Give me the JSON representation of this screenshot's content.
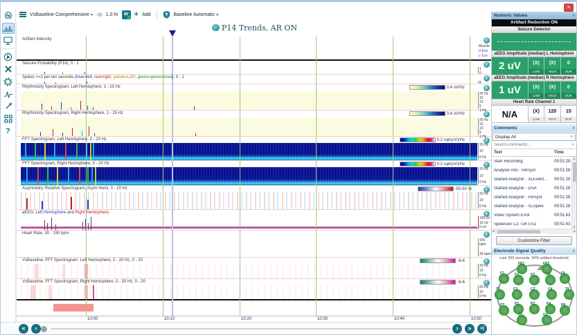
{
  "window": {
    "close": "×"
  },
  "glyphs": {
    "caret": "▾",
    "arrows": "◁▷",
    "plus": "+",
    "help": "?",
    "info": "i",
    "back_fast": "«",
    "back": "‹",
    "fwd": "›",
    "fwd_fast": "»",
    "fwd_end": "»|",
    "panel_close": "×",
    "dropdown_caret": "˅",
    "search": "⌕",
    "up": "▲",
    "down": "▼",
    "hleft": "◂",
    "hright": "▸"
  },
  "toolbar": {
    "preset": "VsBaseline Comprehensive",
    "timescale": "1.0 hr",
    "ar_badge": "ar",
    "add_label": "Add",
    "baseline": "Baseline Automatic"
  },
  "main": {
    "title": "P14 Trends, AR ON",
    "time_ticks": [
      "10:00",
      "10:10",
      "10:20",
      "10:30",
      "10:40",
      "10:50"
    ],
    "rows": [
      {
        "id": "artifact-intensity",
        "label": "Artifact Intensity",
        "axis": [
          "Muscle",
          "V-Eye",
          "L-Eye"
        ]
      },
      {
        "id": "seizure-probability",
        "label": "Seizure Probability (P14), 0 - 1",
        "axis": [
          "1",
          "0"
        ]
      },
      {
        "id": "spikes",
        "parts": [
          {
            "t": "Spikes >=3 per ten seconds ("
          },
          {
            "t": "blue=left",
            "c": "#2040c0"
          },
          {
            "t": ", "
          },
          {
            "t": "red=right",
            "c": "#c02020"
          },
          {
            "t": ", "
          },
          {
            "t": "yellow=L&R",
            "c": "#a89000"
          },
          {
            "t": ", "
          },
          {
            "t": "green=generalized",
            "c": "#1e8a2e"
          },
          {
            "t": "), 0 - 1"
          }
        ],
        "axis": [
          "8"
        ]
      },
      {
        "id": "rhythmicity-left",
        "label": "Rhythmicity Spectrogram, Left Hemisphere, 1 - 25 Hz",
        "scale": "0.4 uV/Hz",
        "axis": [
          "25 Hz",
          "15",
          "10",
          "5",
          "1 Hz"
        ]
      },
      {
        "id": "rhythmicity-right",
        "label": "Rhythmicity Spectrogram, Right Hemisphere, 1 - 25 Hz",
        "scale": "0.4 uV/Hz",
        "axis": [
          "25 Hz",
          "15",
          "10",
          "5",
          "1 Hz"
        ]
      },
      {
        "id": "fft-left",
        "label": "FFT Spectrogram, Left Hemisphere, 0 - 20 Hz",
        "scale": "0.2 sqrt(uV)/Hz",
        "axis": [
          "20 Hz",
          "10",
          "0 Hz"
        ]
      },
      {
        "id": "fft-right",
        "label": "FFT Spectrogram, Right Hemisphere, 0 - 20 Hz",
        "scale": "0.2 sqrt(uV)/Hz",
        "axis": [
          "20 Hz",
          "10",
          "0 Hz"
        ]
      },
      {
        "id": "asymmetry",
        "label": "Asymmetry, Relative Spectrogram, Asym Hemi, 0 - 20 Hz",
        "scale": "-50-50 %",
        "axis": [
          "20 Hz",
          "10",
          "0 Hz"
        ]
      },
      {
        "id": "aeeg",
        "parts": [
          {
            "t": "aEEG, "
          },
          {
            "t": "Left Hemisphere",
            "c": "#2040c0"
          },
          {
            "t": " and "
          },
          {
            "t": "Right Hemisphere",
            "c": "#c02020"
          },
          {
            "t": "."
          }
        ],
        "axis": [
          "100 uV",
          "10 uV",
          "0 uV"
        ]
      },
      {
        "id": "heart-rate",
        "label": "Heart Rate, 30 - 150 bpm",
        "axis": [
          "150 bpm",
          "30 bpm"
        ]
      },
      {
        "id": "vsbaseline-left",
        "label": "VsBaseline, FFT Spectrogram, Left Hemisphere, 0 - 20 Hz, 0 - 20",
        "scale": "-6-6",
        "axis": [
          "20 Hz",
          "10",
          "0 Hz"
        ]
      },
      {
        "id": "vsbaseline-right",
        "label": "VsBaseline, FFT Spectrogram, Right Hemisphere, 0 - 20 Hz, 0 - 20",
        "scale": "-6-6",
        "axis": [
          "20 Hz",
          "10",
          "0 Hz"
        ]
      }
    ]
  },
  "numeric_values": {
    "title": "Numeric Values",
    "artifact_reduction": "Artifact Reduction ON",
    "seizure_detector_title": "Seizure Detector",
    "low_label": "LOW",
    "high_label": "HIGH",
    "dur_label": "DUR",
    "aeeg_left": {
      "title": "aEEG Amplitude (median) L Hemisphere",
      "value": "2 uV",
      "low": "(X)",
      "high": "(X)",
      "dur": "0"
    },
    "aeeg_right": {
      "title": "aEEG Amplitude (median) R Hemisphere",
      "value": "1 uV",
      "low": "(X)",
      "high": "(X)",
      "dur": "0"
    },
    "heart_rate": {
      "title": "Heart Rate Channel 1",
      "value": "N/A",
      "low": "(X)",
      "high": "120",
      "dur": "15"
    }
  },
  "comments": {
    "title": "Comments",
    "filter_value": "Display All",
    "search_placeholder": "Search comments...",
    "col_text": "Text",
    "col_time": "Time",
    "rows": [
      {
        "text": "Start Recording",
        "time": "09:51:28"
      },
      {
        "text": "Analyzer info - Persyst",
        "time": "09:51:28"
      },
      {
        "text": "Started Analyzer - XLEvent...",
        "time": "09:51:28"
      },
      {
        "text": "Started Analyzer - DSA",
        "time": "09:51:28"
      },
      {
        "text": "Started Analyzer - Persyst",
        "time": "09:51:28"
      },
      {
        "text": "Started Analyzer - XLSpike",
        "time": "09:51:28"
      },
      {
        "text": "Video System Error",
        "time": "09:51:43"
      },
      {
        "text": "SpikeGen Cz-T34 0.52",
        "time": "09:51:43"
      }
    ],
    "customize_filter": "Customize Filter"
  },
  "electrode_quality": {
    "title": "Electrode Signal Quality",
    "subtitle": "Last 300 seconds, 50% artifact threshold",
    "electrodes": [
      "FP1",
      "FP2",
      "F7",
      "F3",
      "FZ",
      "F4",
      "F8",
      "T7",
      "C3",
      "CZ",
      "C4",
      "T8",
      "P7",
      "P3",
      "PZ",
      "P4",
      "P8",
      "O1",
      "O2"
    ]
  },
  "colors": {
    "accent": "#17707f",
    "value_green": "#2aa06a",
    "grid_green": "#a6c57c",
    "fft_navy": "#0a1190",
    "rhyth_yellow": "#fbfbe2",
    "cursor": "#b9c0ea",
    "event_bar": "#f69390"
  }
}
